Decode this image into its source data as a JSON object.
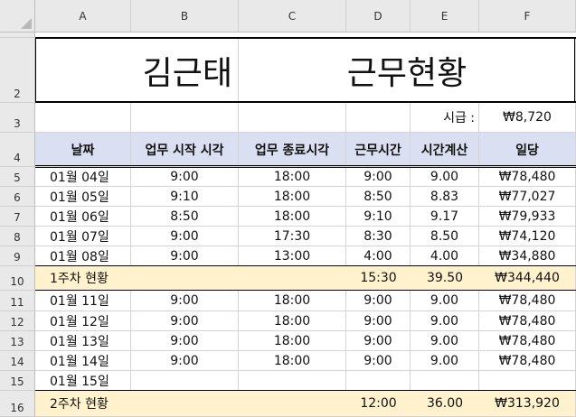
{
  "columns": [
    "A",
    "B",
    "C",
    "D",
    "E",
    "F"
  ],
  "rows": [
    "",
    "2",
    "3",
    "4",
    "5",
    "6",
    "7",
    "8",
    "9",
    "10",
    "11",
    "12",
    "13",
    "14",
    "15",
    "16"
  ],
  "title": {
    "name": "김근태",
    "subtitle": "근무현황"
  },
  "wage": {
    "label": "시급 :",
    "value": "₩8,720"
  },
  "headers": [
    "날짜",
    "업무 시작 시각",
    "업무 종료시각",
    "근무시간",
    "시간계산",
    "일당"
  ],
  "week1": [
    [
      "01월 04일",
      "9:00",
      "18:00",
      "9:00",
      "9.00",
      "₩78,480"
    ],
    [
      "01월 05일",
      "9:10",
      "18:00",
      "8:50",
      "8.83",
      "₩77,027"
    ],
    [
      "01월 06일",
      "8:50",
      "18:00",
      "9:10",
      "9.17",
      "₩79,933"
    ],
    [
      "01월 07일",
      "9:00",
      "17:30",
      "8:30",
      "8.50",
      "₩74,120"
    ],
    [
      "01월 08일",
      "9:00",
      "13:00",
      "4:00",
      "4.00",
      "₩34,880"
    ]
  ],
  "summary1": {
    "label": "1주차 현황",
    "hours": "15:30",
    "calc": "39.50",
    "pay": "₩344,440"
  },
  "week2": [
    [
      "01월 11일",
      "9:00",
      "18:00",
      "9:00",
      "9.00",
      "₩78,480"
    ],
    [
      "01월 12일",
      "9:00",
      "18:00",
      "9:00",
      "9.00",
      "₩78,480"
    ],
    [
      "01월 13일",
      "9:00",
      "18:00",
      "9:00",
      "9.00",
      "₩78,480"
    ],
    [
      "01월 14일",
      "9:00",
      "18:00",
      "9:00",
      "9.00",
      "₩78,480"
    ],
    [
      "01월 15일",
      "",
      "",
      "",
      "",
      ""
    ]
  ],
  "summary2": {
    "label": "2주차 현황",
    "hours": "12:00",
    "calc": "36.00",
    "pay": "₩313,920"
  }
}
